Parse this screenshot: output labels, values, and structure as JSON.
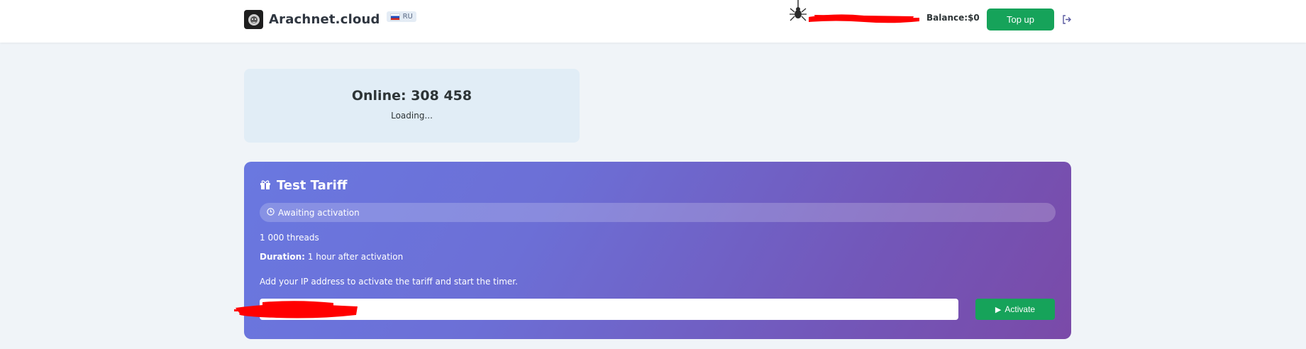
{
  "header": {
    "brand": "Arachnet.cloud",
    "language": "RU",
    "balance_label": "Balance:",
    "balance_value": "$0",
    "topup_label": "Top up",
    "logo_icon": "lion-logo-icon",
    "spider_icon": "spider-icon",
    "logout_icon": "logout-icon"
  },
  "online": {
    "title": "Online: 308 458",
    "status": "Loading..."
  },
  "tariff": {
    "title": "Test Tariff",
    "status": "Awaiting activation",
    "threads": "1 000 threads",
    "duration_label": "Duration:",
    "duration_value": "1 hour after activation",
    "hint": "Add your IP address to activate the tariff and start the timer.",
    "ip_value": "",
    "activate_label": "Activate",
    "gift_icon": "gift-icon",
    "clock_icon": "clock-icon",
    "play_icon": "play-icon"
  },
  "colors": {
    "accent_green": "#16a35a",
    "card_gradient_start": "#6a78e0",
    "card_gradient_end": "#7a4aa8",
    "page_bg": "#f0f4f8"
  }
}
